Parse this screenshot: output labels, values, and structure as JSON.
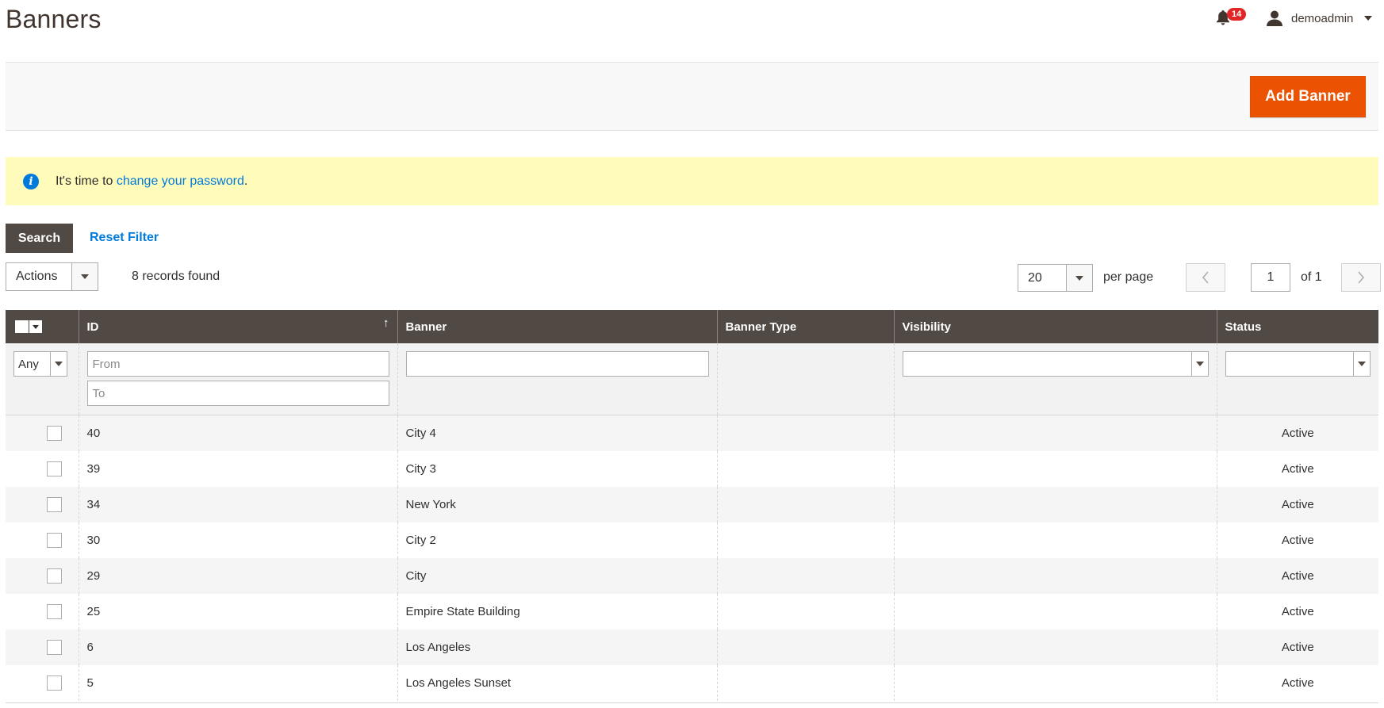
{
  "header": {
    "title": "Banners",
    "notification_count": "14",
    "user_name": "demoadmin"
  },
  "action_bar": {
    "add_label": "Add Banner"
  },
  "message": {
    "prefix": "It's time to ",
    "link": "change your password",
    "suffix": "."
  },
  "controls": {
    "search_label": "Search",
    "reset_label": "Reset Filter",
    "actions_label": "Actions",
    "records_found": "8 records found",
    "per_page_value": "20",
    "per_page_label": "per page",
    "page_value": "1",
    "of_label": "of 1"
  },
  "grid": {
    "columns": [
      "ID",
      "Banner",
      "Banner Type",
      "Visibility",
      "Status"
    ],
    "filters": {
      "any": "Any",
      "id_from": "From",
      "id_to": "To",
      "banner": "",
      "visibility": "",
      "status": ""
    },
    "rows": [
      {
        "id": "40",
        "banner": "City 4",
        "type": "",
        "visibility": "",
        "status": "Active"
      },
      {
        "id": "39",
        "banner": "City 3",
        "type": "",
        "visibility": "",
        "status": "Active"
      },
      {
        "id": "34",
        "banner": "New York",
        "type": "",
        "visibility": "",
        "status": "Active"
      },
      {
        "id": "30",
        "banner": "City 2",
        "type": "",
        "visibility": "",
        "status": "Active"
      },
      {
        "id": "29",
        "banner": "City",
        "type": "",
        "visibility": "",
        "status": "Active"
      },
      {
        "id": "25",
        "banner": "Empire State Building",
        "type": "",
        "visibility": "",
        "status": "Active"
      },
      {
        "id": "6",
        "banner": "Los Angeles",
        "type": "",
        "visibility": "",
        "status": "Active"
      },
      {
        "id": "5",
        "banner": "Los Angeles Sunset",
        "type": "",
        "visibility": "",
        "status": "Active"
      }
    ]
  },
  "colors": {
    "accent": "#eb5202",
    "header_bg": "#514943",
    "link": "#007bdb",
    "message_bg": "#fffbbb",
    "badge": "#e22626"
  },
  "icons": {
    "notification": "bell-icon",
    "user": "user-icon",
    "info": "info-icon",
    "sort": "arrow-up-icon"
  }
}
